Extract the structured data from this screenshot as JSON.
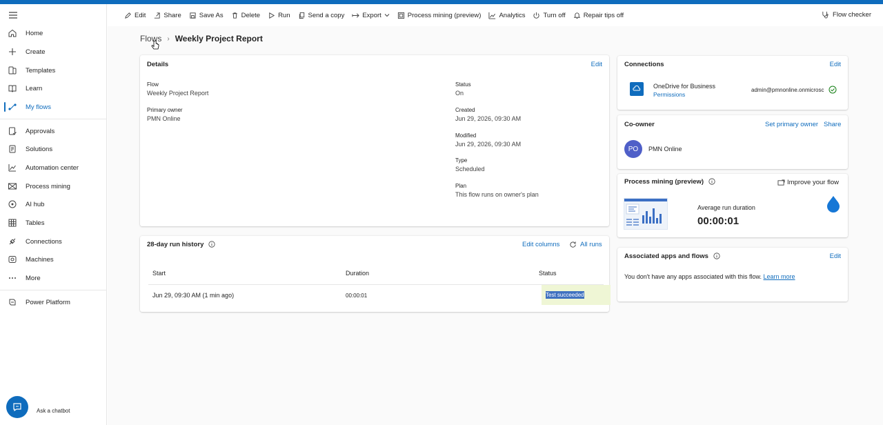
{
  "sidebar": {
    "items": [
      {
        "label": "Home",
        "icon": "home-icon"
      },
      {
        "label": "Create",
        "icon": "plus-icon"
      },
      {
        "label": "Templates",
        "icon": "templates-icon"
      },
      {
        "label": "Learn",
        "icon": "book-icon"
      },
      {
        "label": "My flows",
        "icon": "flows-icon"
      },
      {
        "label": "Approvals",
        "icon": "approvals-icon"
      },
      {
        "label": "Solutions",
        "icon": "solutions-icon"
      },
      {
        "label": "Automation center",
        "icon": "chart-icon"
      },
      {
        "label": "Process mining",
        "icon": "process-mining-icon"
      },
      {
        "label": "AI hub",
        "icon": "ai-hub-icon"
      },
      {
        "label": "Tables",
        "icon": "table-icon"
      },
      {
        "label": "Connections",
        "icon": "connections-icon"
      },
      {
        "label": "Machines",
        "icon": "machines-icon"
      },
      {
        "label": "More",
        "icon": "more-icon"
      },
      {
        "label": "Power Platform",
        "icon": "power-platform-icon"
      }
    ],
    "chatbot_label": "Ask a chatbot"
  },
  "commandbar": {
    "edit": "Edit",
    "share": "Share",
    "save_as": "Save As",
    "delete": "Delete",
    "run": "Run",
    "send_copy": "Send a copy",
    "export": "Export",
    "process_mining": "Process mining (preview)",
    "analytics": "Analytics",
    "turn_off": "Turn off",
    "repair_tips": "Repair tips off",
    "flow_checker": "Flow checker"
  },
  "breadcrumb": {
    "parent": "Flows",
    "current": "Weekly Project Report"
  },
  "details": {
    "title": "Details",
    "edit": "Edit",
    "flow_label": "Flow",
    "flow_value": "Weekly Project Report",
    "owner_label": "Primary owner",
    "owner_value": "PMN Online",
    "status_label": "Status",
    "status_value": "On",
    "created_label": "Created",
    "created_value": "Jun 29, 2026, 09:30 AM",
    "modified_label": "Modified",
    "modified_value": "Jun 29, 2026, 09:30 AM",
    "type_label": "Type",
    "type_value": "Scheduled",
    "plan_label": "Plan",
    "plan_value": "This flow runs on owner's plan"
  },
  "run_history": {
    "title": "28-day run history",
    "edit_columns": "Edit columns",
    "all_runs": "All runs",
    "columns": [
      "Start",
      "Duration",
      "Status"
    ],
    "rows": [
      {
        "start": "Jun 29, 09:30 AM (1 min ago)",
        "duration": "00:00:01",
        "status": "Test succeeded"
      }
    ]
  },
  "connections": {
    "title": "Connections",
    "edit": "Edit",
    "name": "OneDrive for Business",
    "permissions": "Permissions",
    "account": "admin@pmnonline.onmicrosc"
  },
  "coowner": {
    "title": "Co-owner",
    "set_primary": "Set primary owner",
    "share": "Share",
    "initials": "PO",
    "name": "PMN Online"
  },
  "process_mining": {
    "title": "Process mining (preview)",
    "improve": "Improve your flow",
    "avg_label": "Average run duration",
    "avg_value": "00:00:01"
  },
  "associated": {
    "title": "Associated apps and flows",
    "edit": "Edit",
    "text": "You don't have any apps associated with this flow.",
    "learn_more": "Learn more"
  },
  "colors": {
    "accent": "#0f6cbd",
    "success_bg": "#eff6d5",
    "avatar": "#4f5fc8"
  }
}
